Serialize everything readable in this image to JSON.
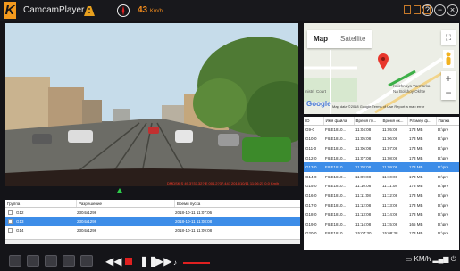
{
  "app": {
    "title": "CamcamPlayer",
    "speed_value": "43",
    "speed_unit": "Km/h"
  },
  "window_controls": {
    "help": "?",
    "minimize": "−",
    "close": "×"
  },
  "video": {
    "overlay_text": "DMDSK  S 49.3?37.32?  E 004.2?37.44?  2018/10/11 11:06:21  0.0 Km/h"
  },
  "map": {
    "tab_map": "Map",
    "tab_satellite": "Satellite",
    "labels": [
      "Knizhnaya Yarmarka",
      "Na Bolshoy Okhte",
      "Court",
      "nistri"
    ],
    "google": "Google",
    "footer": "Map data ©2018 Google   Terms of Use   Report a map error"
  },
  "file_table": {
    "headers": [
      "ID",
      "Имя файла",
      "Время пу...",
      "Время ок...",
      "Размер ф...",
      "Папка"
    ],
    "selected_index": 4,
    "rows": [
      [
        "G9-0",
        "FILE1810...",
        "11:04:08",
        "11:05:08",
        "173 MB",
        "D:\\pre"
      ],
      [
        "G10-0",
        "FILE1810...",
        "11:05:08",
        "11:06:08",
        "173 MB",
        "D:\\pre"
      ],
      [
        "G11-0",
        "FILE1810...",
        "11:06:08",
        "11:07:08",
        "173 MB",
        "D:\\pre"
      ],
      [
        "G12-0",
        "FILE1810...",
        "11:07:08",
        "11:08:08",
        "173 MB",
        "D:\\pre"
      ],
      [
        "G13-0",
        "FILE1810...",
        "11:08:08",
        "11:09:08",
        "173 MB",
        "D:\\pre"
      ],
      [
        "G14-0",
        "FILE1810...",
        "11:09:08",
        "11:10:08",
        "173 MB",
        "D:\\pre"
      ],
      [
        "G15-0",
        "FILE1810...",
        "11:10:08",
        "11:11:08",
        "173 MB",
        "D:\\pre"
      ],
      [
        "G16-0",
        "FILE1810...",
        "11:11:08",
        "11:12:08",
        "173 MB",
        "D:\\pre"
      ],
      [
        "G17-0",
        "FILE1810...",
        "11:12:08",
        "11:13:08",
        "173 MB",
        "D:\\pre"
      ],
      [
        "G18-0",
        "FILE1810...",
        "11:13:08",
        "11:14:08",
        "173 MB",
        "D:\\pre"
      ],
      [
        "G19-0",
        "FILE1810...",
        "11:14:08",
        "11:15:08",
        "165 MB",
        "D:\\pre"
      ],
      [
        "G20-0",
        "FILE1810...",
        "15:07:30",
        "15:08:38",
        "173 MB",
        "D:\\pre"
      ]
    ]
  },
  "group_table": {
    "headers": [
      "Группа",
      "Разрешение",
      "Время пуска"
    ],
    "rows": [
      {
        "group": "G12",
        "resolution": "2304x1296",
        "time": "2018-10-11 11:07:06"
      },
      {
        "group": "G13",
        "resolution": "2304x1296",
        "time": "2018-10-11 11:08:08"
      },
      {
        "group": "G14",
        "resolution": "2304x1296",
        "time": "2018-10-11 11:09:08"
      }
    ],
    "selected_index": 1
  },
  "status": {
    "distance_unit": "KM/h"
  }
}
